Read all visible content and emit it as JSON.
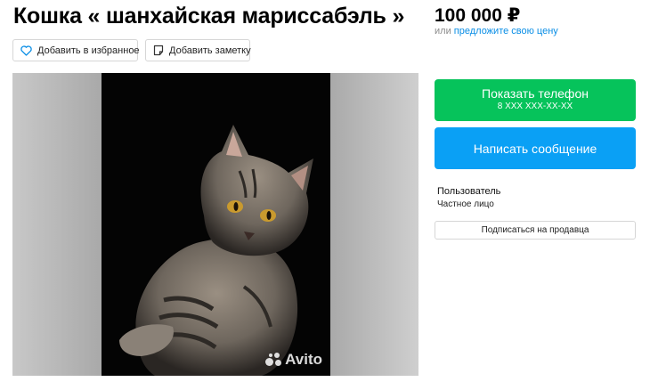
{
  "listing": {
    "title": "Кошка « шанхайская мариссабэль »",
    "favorite_label": "Добавить в избранное",
    "note_label": "Добавить заметку",
    "photo_alt": "cat-photo",
    "watermark": "Avito"
  },
  "pricing": {
    "price": "100 000 ₽",
    "or_text": "или",
    "offer_link": "предложите свою цену"
  },
  "contact": {
    "phone_label": "Показать телефон",
    "phone_mask": "8 XXX XXX-XX-XX",
    "message_label": "Написать сообщение"
  },
  "seller": {
    "name": "Пользователь",
    "type": "Частное лицо",
    "subscribe_label": "Подписаться на продавца"
  },
  "icons": {
    "favorite": "heart-icon",
    "note": "note-icon",
    "watermark": "avito-logo-icon"
  },
  "colors": {
    "phone_button": "#06c35b",
    "message_button": "#0aa0f5",
    "link": "#0a8ee6"
  }
}
